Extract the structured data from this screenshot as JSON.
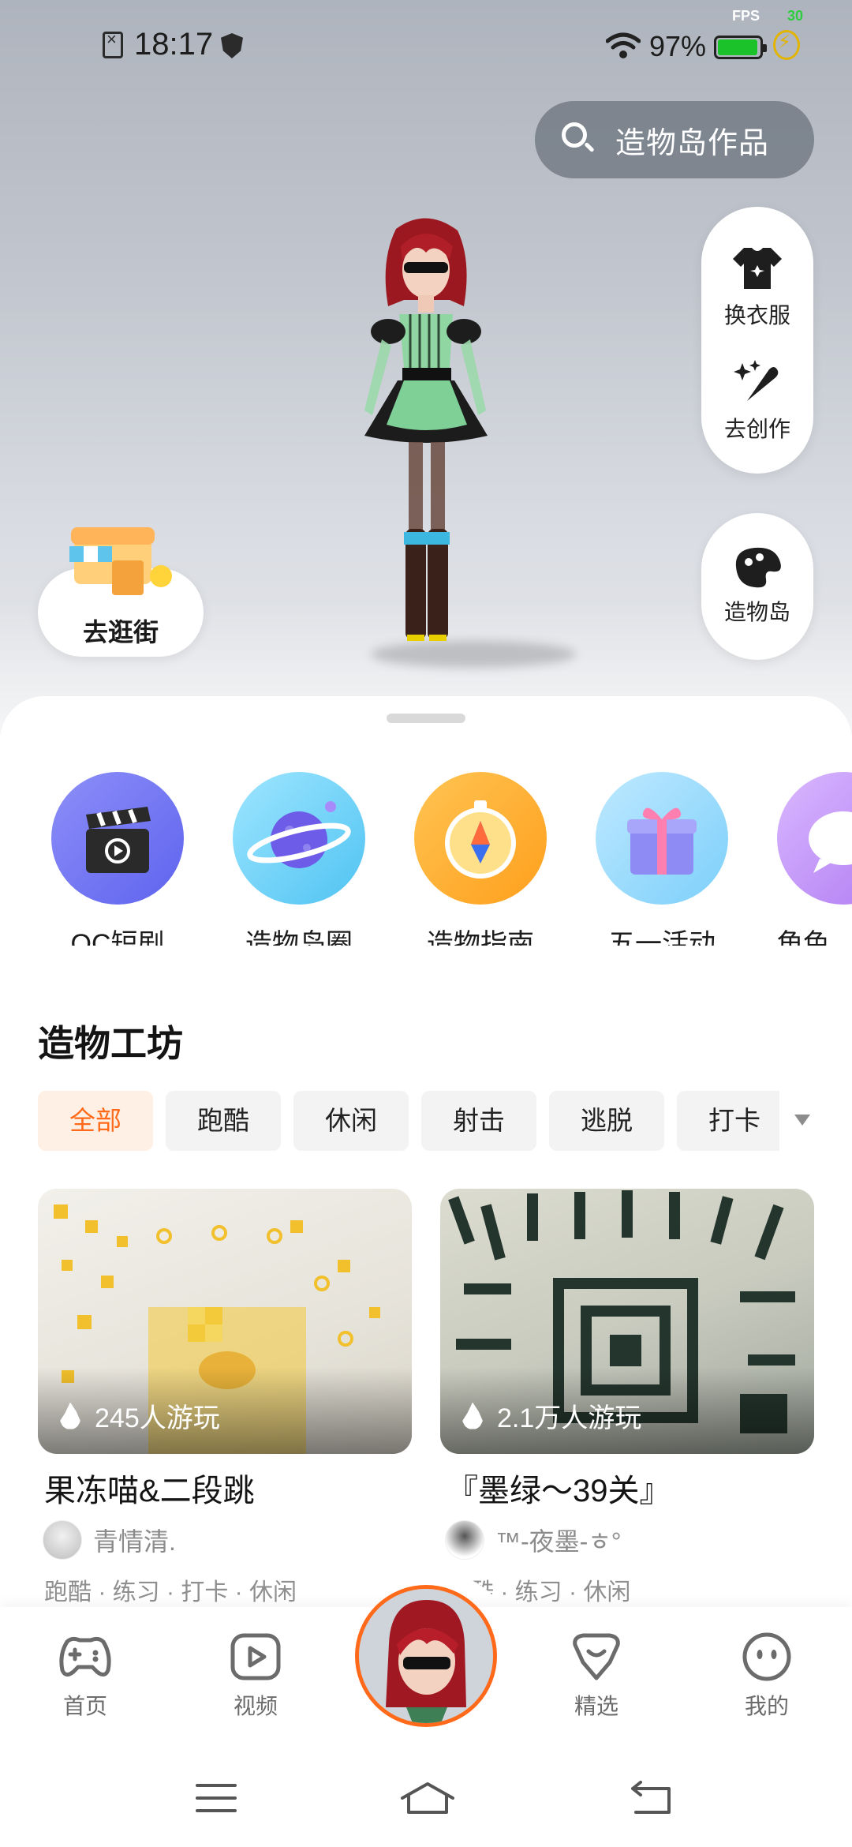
{
  "status_bar": {
    "time": "18:17",
    "battery_percent": "97%",
    "fps_label": "FPS",
    "fps_value": "30",
    "battery_color": "#1bc22a"
  },
  "search": {
    "label": "造物岛作品",
    "icon": "search-icon"
  },
  "side_actions": [
    {
      "label": "换衣服",
      "icon": "tshirt-icon"
    },
    {
      "label": "去创作",
      "icon": "magic-wand-icon"
    }
  ],
  "island_button": {
    "label": "造物岛",
    "icon": "palette-icon"
  },
  "shop_button": {
    "label": "去逛街",
    "icon": "shop-icon"
  },
  "quick_entries": [
    {
      "label": "OC短剧",
      "icon": "clapperboard-icon"
    },
    {
      "label": "造物岛圈",
      "icon": "planet-icon"
    },
    {
      "label": "造物指南",
      "icon": "compass-icon"
    },
    {
      "label": "五一活动",
      "icon": "gift-icon"
    },
    {
      "label": "角色",
      "icon": "chat-bubble-icon"
    }
  ],
  "workshop": {
    "title": "造物工坊",
    "chips": [
      "全部",
      "跑酷",
      "休闲",
      "射击",
      "逃脱",
      "打卡"
    ],
    "active_chip": "全部",
    "accent_color": "#ff6a1a",
    "games": [
      {
        "title": "果冻喵&二段跳",
        "plays": "245人游玩",
        "author": "青情清.",
        "tags": "跑酷 · 练习 · 打卡 · 休闲"
      },
      {
        "title": "『墨绿～39关』",
        "plays": "2.1万人游玩",
        "author": "™-夜墨-ㅎ°",
        "tags": "跑酷 · 练习 · 休闲"
      }
    ]
  },
  "bottom_nav": [
    {
      "label": "首页",
      "icon": "gamepad-icon"
    },
    {
      "label": "视频",
      "icon": "video-play-icon"
    },
    {
      "label": "精选",
      "icon": "heart-badge-icon"
    },
    {
      "label": "我的",
      "icon": "smiley-icon"
    }
  ]
}
